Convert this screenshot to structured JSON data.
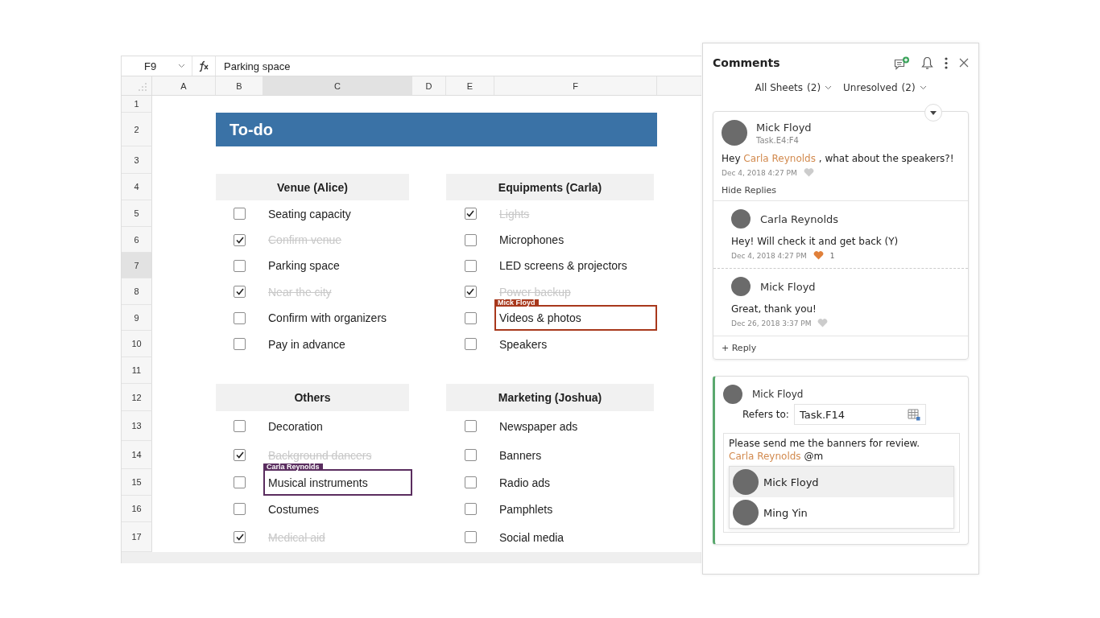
{
  "sheet": {
    "name_box": "F9",
    "formula": "Parking space",
    "columns": [
      {
        "label": "A",
        "selected": false
      },
      {
        "label": "B",
        "selected": false
      },
      {
        "label": "C",
        "selected": true
      },
      {
        "label": "D",
        "selected": false
      },
      {
        "label": "E",
        "selected": false
      },
      {
        "label": "F",
        "selected": false
      }
    ],
    "rows": [
      {
        "label": "1",
        "selected": false
      },
      {
        "label": "2",
        "selected": false
      },
      {
        "label": "3",
        "selected": false
      },
      {
        "label": "4",
        "selected": false
      },
      {
        "label": "5",
        "selected": false
      },
      {
        "label": "6",
        "selected": false
      },
      {
        "label": "7",
        "selected": true
      },
      {
        "label": "8",
        "selected": false
      },
      {
        "label": "9",
        "selected": false
      },
      {
        "label": "10",
        "selected": false
      },
      {
        "label": "11",
        "selected": false
      },
      {
        "label": "12",
        "selected": false
      },
      {
        "label": "13",
        "selected": false
      },
      {
        "label": "14",
        "selected": false
      },
      {
        "label": "15",
        "selected": false
      },
      {
        "label": "16",
        "selected": false
      },
      {
        "label": "17",
        "selected": false
      }
    ],
    "title": "To-do",
    "sections": [
      {
        "heading": "Venue (Alice)",
        "items": [
          {
            "label": "Seating capacity",
            "checked": false
          },
          {
            "label": "Confirm venue",
            "checked": true
          },
          {
            "label": "Parking space",
            "checked": false
          },
          {
            "label": "Near the city",
            "checked": true
          },
          {
            "label": "Confirm with organizers",
            "checked": false
          },
          {
            "label": "Pay in advance",
            "checked": false
          }
        ]
      },
      {
        "heading": "Equipments (Carla)",
        "items": [
          {
            "label": "Lights",
            "checked": true
          },
          {
            "label": "Microphones",
            "checked": false
          },
          {
            "label": "LED screens & projectors",
            "checked": false
          },
          {
            "label": "Power backup",
            "checked": true
          },
          {
            "label": "Videos & photos",
            "checked": false,
            "collaborator": {
              "name": "Mick Floyd",
              "color": "#a8381c"
            }
          },
          {
            "label": "Speakers",
            "checked": false
          }
        ]
      },
      {
        "heading": "Others",
        "items": [
          {
            "label": "Decoration",
            "checked": false
          },
          {
            "label": "Background dancers",
            "checked": true
          },
          {
            "label": "Musical instruments",
            "checked": false,
            "collaborator": {
              "name": "Carla Reynolds",
              "color": "#5a2d5f"
            }
          },
          {
            "label": "Costumes",
            "checked": false
          },
          {
            "label": "Medical aid",
            "checked": true
          }
        ]
      },
      {
        "heading": "Marketing (Joshua)",
        "items": [
          {
            "label": "Newspaper ads",
            "checked": false
          },
          {
            "label": "Banners",
            "checked": false
          },
          {
            "label": "Radio ads",
            "checked": false
          },
          {
            "label": "Pamphlets",
            "checked": false
          },
          {
            "label": "Social media",
            "checked": false
          }
        ]
      }
    ]
  },
  "comments": {
    "title": "Comments",
    "filters": [
      {
        "label": "All Sheets",
        "count": "(2)"
      },
      {
        "label": "Unresolved",
        "count": "(2)"
      }
    ],
    "thread": {
      "author": "Mick Floyd",
      "reference": "Task.E4:F4",
      "text": [
        {
          "kind": "plain",
          "text": "Hey "
        },
        {
          "kind": "mention",
          "text": "Carla Reynolds"
        },
        {
          "kind": "plain",
          "text": " , what about the speakers?!"
        }
      ],
      "date": "Dec 4, 2018 4:27 PM",
      "liked": false,
      "toggle": "Hide Replies",
      "replies": [
        {
          "author": "Carla Reynolds",
          "text": "Hey! Will check it and get back (Y)",
          "date": "Dec 4, 2018 4:27 PM",
          "liked": true,
          "like_count": "1"
        },
        {
          "author": "Mick Floyd",
          "text": "Great, thank you!",
          "date": "Dec 26, 2018 3:37 PM",
          "liked": false
        }
      ],
      "reply_link": "+ Reply"
    },
    "draft": {
      "author": "Mick Floyd",
      "refers_label": "Refers to:",
      "refers_value": "Task.F14",
      "text": [
        {
          "kind": "plain",
          "text": "Please send me the banners for review. "
        },
        {
          "kind": "mention",
          "text": "Carla Reynolds"
        },
        {
          "kind": "plain",
          "text": " @m"
        }
      ],
      "suggestions": [
        {
          "name": "Mick Floyd",
          "selected": true
        },
        {
          "name": "Ming Yin",
          "selected": false
        }
      ]
    }
  }
}
